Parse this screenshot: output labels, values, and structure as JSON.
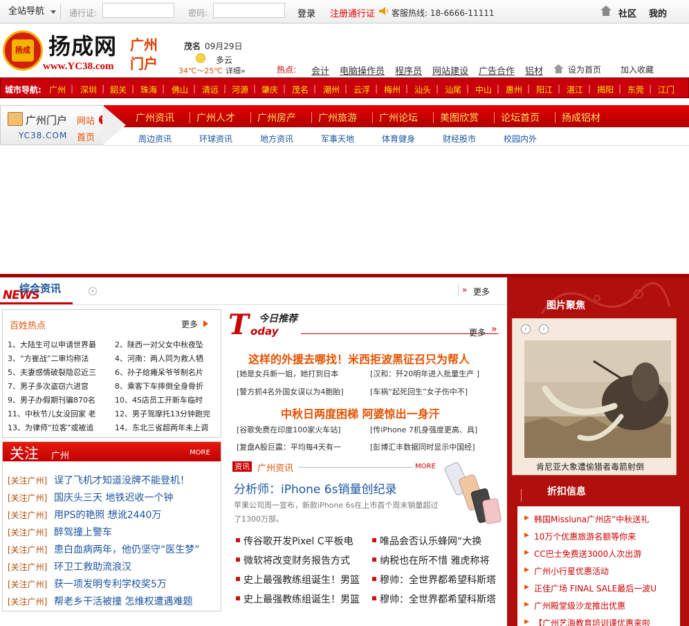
{
  "topbar": {
    "site_nav": "全站导航",
    "pass_label": "通行证:",
    "pwd_label": "密码:",
    "login": "登录",
    "register": "注册通行证",
    "hotline": "客服热线: 18-6666-11111",
    "community": "社区",
    "mine": "我的"
  },
  "logo": {
    "seal_text": "扬成",
    "name": "扬成网",
    "url": "www.YC38.com",
    "city": "广州门户"
  },
  "weather": {
    "city": "茂名",
    "date": "09月29日",
    "desc": "多云",
    "temp": "34℃～25℃",
    "detail": "详细»"
  },
  "hot": {
    "label": "热点:",
    "items": [
      "会计",
      "电脑操作员",
      "程序员",
      "网站建设",
      "广告合作",
      "铝材"
    ],
    "set_home": "设为首页",
    "favorite": "加入收藏"
  },
  "city_nav": {
    "label": "城市导航:",
    "cities": [
      "广州",
      "深圳",
      "韶关",
      "珠海",
      "佛山",
      "清远",
      "河源",
      "肇庆",
      "茂名",
      "潮州",
      "云浮",
      "梅州",
      "汕头",
      "汕尾",
      "中山",
      "惠州",
      "阳江",
      "湛江",
      "揭阳",
      "东莞",
      "江门"
    ]
  },
  "portal": {
    "title": "广州门户",
    "site": "网站",
    "home": "首页",
    "domain": "YC38.COM",
    "tabs": [
      "广州资讯",
      "广州人才",
      "广州房产",
      "广州旅游",
      "广州论坛",
      "美图欣赏",
      "论坛首页",
      "扬成铝材"
    ],
    "sub": [
      "周边资讯",
      "环球资讯",
      "地方资讯",
      "军事天地",
      "体育健身",
      "财经股市",
      "校园内外"
    ]
  },
  "news_header": {
    "title": "综合资讯",
    "badge": "NEWS",
    "more": "更多"
  },
  "hotspots": {
    "title": "百姓热点",
    "more": "更多",
    "items": [
      "1、大陆生可以申请世界最",
      "2、陕西一对父女中秋夜坠",
      "3、“方崔战”二审均称法",
      "4、河南：两人同为救人牺",
      "5、夫妻感情破裂隐忍近三",
      "6、孙子给瘫呆爷爷制名片",
      "7、男子多次盗窃六进宫",
      "8、乘客下车摔倒全身骨折",
      "9、男子办假期刊骗870名",
      "10、4S店员工开新车临时",
      "11、中秋节儿女没回家 老",
      "12、男子驾摩托13分钟跑完",
      "13、为律师“拉客”或被追",
      "14、东北三省超两年未上调"
    ]
  },
  "focus": {
    "title": "关注",
    "city": "广州",
    "more": "MORE",
    "tag": "[关注广州]",
    "items": [
      "误了飞机才知道没牌不能登机！",
      "国庆头三天 地铁迟收一个钟",
      "用PS的艳照 想讹2440万",
      "醉驾撞上警车",
      "患白血病两年，他仍坚守“医生梦”",
      "环卫工救助流浪汉",
      "获一项发明专利学校奖5万",
      "帮老乡干活被撞 怎维权遭遇难题"
    ]
  },
  "today": {
    "logo_t": "T",
    "logo_cn": "今日推荐",
    "logo_sub": "oday",
    "more": "更多",
    "headline1": "这样的外援去哪找！米西拒波黑征召只为帮人",
    "row1": [
      "[她是女兵新一姐，她打到日本",
      "[汉和：歼20明年进入批量生产 ]"
    ],
    "row2": [
      "[警方抓4名外国女误以为4胞胎]",
      "[车祸“起死回生”女子伤中不]"
    ],
    "headline2": "中秋日两度困梯 阿婆惊出一身汗",
    "row3": [
      "[谷歌免费在印度100家火车站]",
      "[传iPhone 7机身强度更高、具]"
    ],
    "row4": [
      "[复盘A股巨震：平均每4天有一",
      "[彭博汇丰数据同时显示中国经]"
    ]
  },
  "gz_news": {
    "badge": "资讯",
    "title": "广州资讯",
    "more": "MORE",
    "headline": "分析师：iPhone 6s销量创纪录",
    "summary": "苹果公司周一宣布，新款iPhone 6s在上市首个周末销量超过了1300万部。",
    "items": [
      [
        "传谷歌开发Pixel C平板电",
        "唯品会否认乐蜂网“大换"
      ],
      [
        "微软将改变财务报告方式",
        "纳税也在所不惜 雅虎称将"
      ],
      [
        "史上最强教练组诞生！男篮",
        "穆帅：全世界都希望科斯塔"
      ],
      [
        "史上最强教练组诞生！男篮",
        "穆帅：全世界都希望科斯塔"
      ]
    ]
  },
  "photo_focus": {
    "title": "图片聚焦",
    "caption": "肯尼亚大象遭偷猎者毒箭射倒"
  },
  "discount": {
    "title": "折扣信息",
    "items": [
      "韩国Missluna广州店”中秋送礼",
      "10万个优惠旅游名额等你来",
      "CC巴士免费送3000人次出游",
      "广州小行星优惠活动",
      "正佳广场 FINAL SALE最后一波U",
      "广州殿堂级沙龙推出优惠",
      "【广州艺海教育培训课优惠来啦"
    ]
  },
  "colors": {
    "brand_red": "#c9000b",
    "orange": "#e35200",
    "link_blue": "#1b55a0"
  }
}
